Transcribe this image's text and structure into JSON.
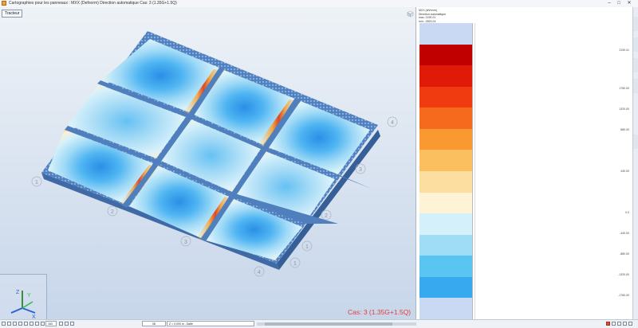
{
  "window": {
    "title": "Cartographies pour les panneaux : MXX (Defnorm) Direction automatique Cas: 3 (1.35G+1.5Q)",
    "minimize": "–",
    "maximize": "□",
    "close": "✕"
  },
  "viewport": {
    "tab_label": "Tracteur",
    "case_label": "Cas: 3 (1.35G+1.5Q)",
    "grid_labels": [
      "1",
      "2",
      "3",
      "4",
      "1",
      "2",
      "3",
      "4",
      "1",
      "1"
    ],
    "axes": {
      "x": "X",
      "y": "Y",
      "z": "Z"
    }
  },
  "legend": {
    "info": [
      "MXX (kN*m/m)",
      "Direction automatique",
      "max: 2190.01",
      "min: -3920.24"
    ],
    "labels": [
      "2190.01",
      "1760.00",
      "1320.00",
      "880.00",
      "440.00",
      "0.0",
      "-440.00",
      "-880.00",
      "-1320.00",
      "-1760.00"
    ],
    "colors": [
      "#c9d9f4",
      "#c00000",
      "#e01a08",
      "#f03a10",
      "#f56a1c",
      "#f99a30",
      "#fbbf60",
      "#fcdfa0",
      "#fff3d6",
      "#d4f1fb",
      "#9fdcf6",
      "#5bc5f2",
      "#37aaef",
      "#c9d9f4"
    ]
  },
  "statusbar": {
    "view_mode": "3D",
    "z_field": "Z = 0,000 m - Dalle",
    "page": "163"
  },
  "colors": {
    "accent": "#e53b3b",
    "slab_blue": "#4a78b6"
  }
}
